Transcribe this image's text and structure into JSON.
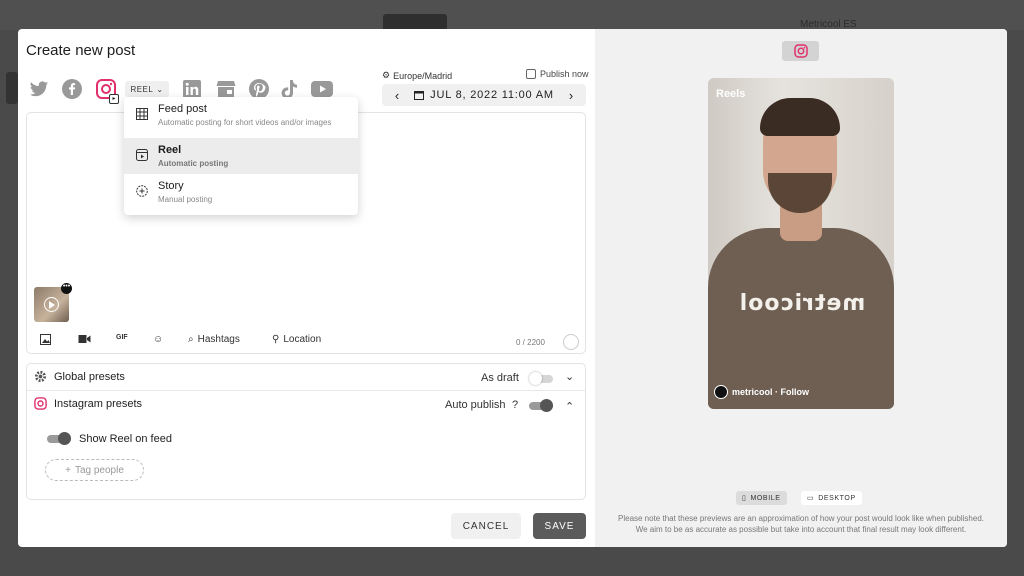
{
  "backdrop": {
    "brand": "Metricool ES"
  },
  "modal": {
    "title": "Create new post",
    "post_type_selected": "REEL",
    "timezone": "Europe/Madrid",
    "publish_now_label": "Publish now",
    "date": "JUL 8, 2022 11:00 AM",
    "dropdown": [
      {
        "label": "Feed post",
        "sub": "Automatic posting for short videos and/or images",
        "icon": "grid-icon"
      },
      {
        "label": "Reel",
        "sub": "Automatic posting",
        "icon": "reel-icon",
        "active": true
      },
      {
        "label": "Story",
        "sub": "Manual posting",
        "icon": "story-icon"
      }
    ],
    "toolbar": {
      "gif": "GIF",
      "hashtags": "Hashtags",
      "location": "Location",
      "counter": "0 / 2200"
    },
    "presets": {
      "global_label": "Global presets",
      "as_draft_label": "As draft",
      "instagram_label": "Instagram presets",
      "auto_publish_label": "Auto publish",
      "auto_publish_help": "?",
      "show_reel_label": "Show Reel on feed",
      "tag_people_label": "Tag people"
    },
    "footer": {
      "cancel": "CANCEL",
      "save": "SAVE"
    }
  },
  "preview": {
    "reels_label": "Reels",
    "shirt_text": "metricool",
    "account": "metricool · Follow",
    "mobile_label": "MOBILE",
    "desktop_label": "DESKTOP",
    "note_line1": "Please note that these previews are an approximation of how your post would look like when published.",
    "note_line2": "We aim to be as accurate as possible but take into account that final result may look different."
  },
  "colors": {
    "instagram": "#e1306c",
    "accent_dark": "#5b5b5b"
  }
}
